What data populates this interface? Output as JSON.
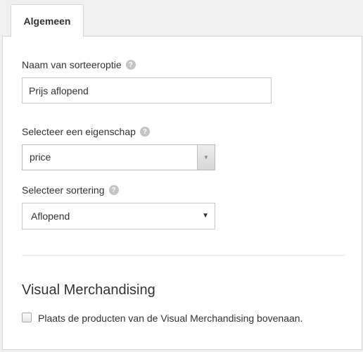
{
  "tabs": [
    {
      "label": "Algemeen",
      "active": true
    }
  ],
  "form": {
    "name_label": "Naam van sorteeroptie",
    "name_value": "Prijs aflopend",
    "property_label": "Selecteer een eigenschap",
    "property_value": "price",
    "sort_label": "Selecteer sortering",
    "sort_value": "Aflopend",
    "help_glyph": "?"
  },
  "visual_merchandising": {
    "title": "Visual Merchandising",
    "checkbox_label": "Plaats de producten van de Visual Merchandising bovenaan.",
    "checked": false
  },
  "icons": {
    "help": "help-icon",
    "combo_arrow": "triangle-down-icon",
    "select_arrow": "chevron-down-icon"
  },
  "colors": {
    "background": "#f0f0f0",
    "panel": "#ffffff",
    "border": "#d6d6d6",
    "text": "#333333",
    "help_badge": "#c4c4c4"
  }
}
